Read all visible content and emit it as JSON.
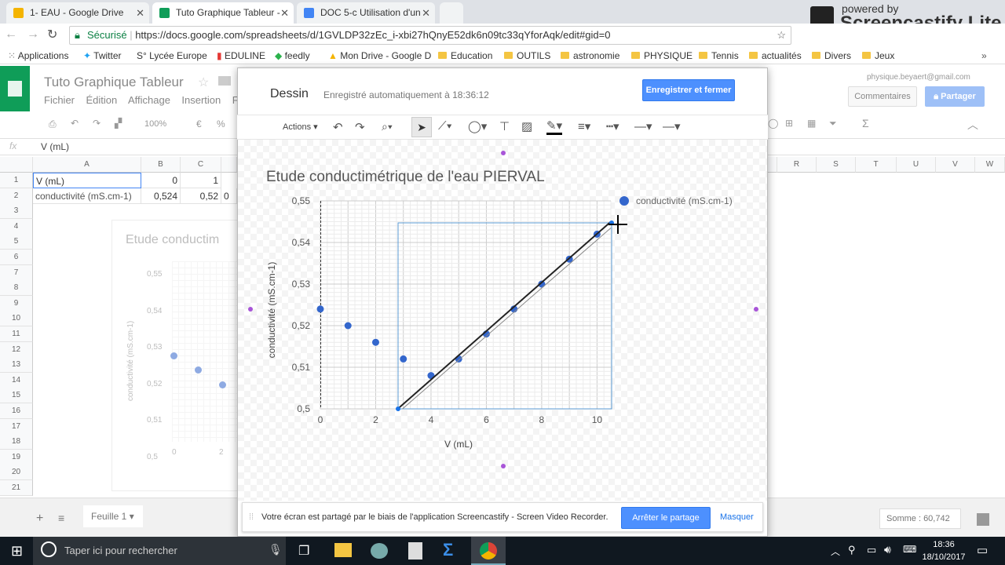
{
  "tabs": [
    {
      "title": "1- EAU - Google Drive",
      "color": "#f4b400"
    },
    {
      "title": "Tuto Graphique Tableur -",
      "color": "#0f9d58"
    },
    {
      "title": "DOC 5-c Utilisation d'un",
      "color": "#4285f4"
    }
  ],
  "omnibox": {
    "secure_label": "Sécurisé",
    "url": "https://docs.google.com/spreadsheets/d/1GVLDP32zEc_i-xbi27hQnyE52dk6n09tc33qYforAqk/edit#gid=0"
  },
  "watermark": {
    "line1": "powered by",
    "line2": "Screencastify Lite"
  },
  "bookmarks": [
    "Applications",
    "Twitter",
    "Lycée Europe",
    "EDULINE",
    "feedly",
    "Mon Drive - Google D",
    "Education",
    "OUTILS",
    "astronomie",
    "PHYSIQUE",
    "Tennis",
    "actualités",
    "Divers",
    "Jeux"
  ],
  "sheet": {
    "title": "Tuto Graphique Tableur",
    "menu": [
      "Fichier",
      "Édition",
      "Affichage",
      "Insertion",
      "Fo"
    ],
    "user_email": "physique.beyaert@gmail.com",
    "comments_label": "Commentaires",
    "share_label": "Partager",
    "zoom": "100%",
    "currency": "€",
    "percent": "%",
    "fx_label": "fx",
    "formula_value": "V (mL)",
    "col_headers": [
      "A",
      "B",
      "C",
      "R",
      "S",
      "T",
      "U",
      "V",
      "W"
    ],
    "rows": [
      "1",
      "2",
      "3",
      "4",
      "5",
      "6",
      "7",
      "8",
      "9",
      "10",
      "11",
      "12",
      "13",
      "14",
      "15",
      "16",
      "17",
      "18",
      "19",
      "20",
      "21"
    ],
    "cells": {
      "a1": "V (mL)",
      "b1": "0",
      "c1": "1",
      "a2": "conductivité (mS.cm-1)",
      "b2": "0,524",
      "c2": "0,52",
      "d2": "0"
    },
    "sheet_tab": "Feuille 1",
    "sum_label": "Somme : 60,742"
  },
  "drawing": {
    "title": "Dessin",
    "autosave": "Enregistré automatiquement à 18:36:12",
    "save_close": "Enregistrer et fermer",
    "actions": "Actions"
  },
  "chart_data": {
    "type": "scatter",
    "title": "Etude conductimétrique de l'eau PIERVAL",
    "xlabel": "V (mL)",
    "ylabel": "conductivité (mS.cm-1)",
    "legend": "conductivité (mS.cm-1)",
    "legend_position": "top-right",
    "grid": true,
    "xlim": [
      0,
      10.5
    ],
    "ylim": [
      0.5,
      0.55
    ],
    "xticks": [
      0,
      2,
      4,
      6,
      8,
      10
    ],
    "yticks": [
      "0,5",
      "0,51",
      "0,52",
      "0,53",
      "0,54",
      "0,55"
    ],
    "yticks_values": [
      0.5,
      0.51,
      0.52,
      0.53,
      0.54,
      0.55
    ],
    "series": [
      {
        "name": "conductivité (mS.cm-1)",
        "x": [
          0,
          1,
          2,
          3,
          4,
          5,
          6,
          7,
          8,
          9,
          10
        ],
        "y": [
          0.524,
          0.52,
          0.516,
          0.512,
          0.508,
          0.512,
          0.518,
          0.524,
          0.53,
          0.536,
          0.542
        ],
        "color": "#3366cc"
      }
    ],
    "drawn_line": {
      "x": [
        2.8,
        10.5
      ],
      "y": [
        0.5,
        0.545
      ]
    },
    "background_chart": {
      "title": "Etude conductim",
      "yticks": [
        "0,55",
        "0,54",
        "0,53",
        "0,52",
        "0,51",
        "0,5"
      ],
      "xticks": [
        "0",
        "2"
      ],
      "ylabel": "conductivité (mS.cm-1)"
    }
  },
  "sharebar": {
    "message": "Votre écran est partagé par le biais de l'application Screencastify - Screen Video Recorder.",
    "stop": "Arrêter le partage",
    "hide": "Masquer"
  },
  "taskbar": {
    "search": "Taper ici pour rechercher",
    "time": "18:36",
    "date": "18/10/2017"
  }
}
